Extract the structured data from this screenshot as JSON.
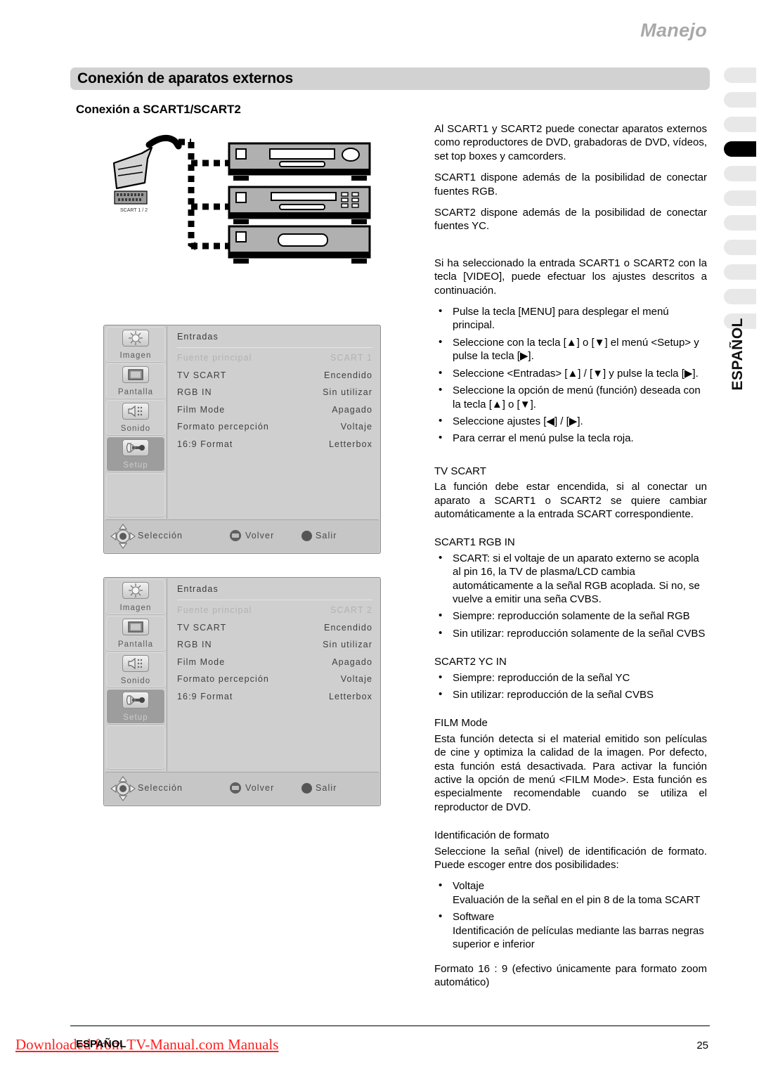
{
  "header": {
    "running_title": "Manejo",
    "section_title": "Conexión de aparatos externos",
    "subtitle": "Conexión a SCART1/SCART2"
  },
  "side_tab": {
    "language_label": "ESPAÑOL",
    "tab_count": 11,
    "active_tab_index": 4,
    "inactive_color": "#e8e8e8",
    "active_color": "#000000"
  },
  "diagram": {
    "connector_label": "SCART 1 / 2",
    "device_count": 3
  },
  "osd_menus": [
    {
      "categories": [
        {
          "label": "Imagen",
          "icon": "picture-icon",
          "selected": false
        },
        {
          "label": "Pantalla",
          "icon": "screen-icon",
          "selected": false
        },
        {
          "label": "Sonido",
          "icon": "speaker-icon",
          "selected": false
        },
        {
          "label": "Setup",
          "icon": "tools-icon",
          "selected": true
        }
      ],
      "heading": "Entradas",
      "rows": [
        {
          "key": "Fuente principal",
          "value": "SCART 1",
          "dimmed": true
        },
        {
          "key": "TV SCART",
          "value": "Encendido",
          "dimmed": false
        },
        {
          "key": "RGB IN",
          "value": "Sin utilizar",
          "dimmed": false
        },
        {
          "key": "Film Mode",
          "value": "Apagado",
          "dimmed": false
        },
        {
          "key": "Formato percepción",
          "value": "Voltaje",
          "dimmed": false
        },
        {
          "key": "16:9 Format",
          "value": "Letterbox",
          "dimmed": false
        }
      ],
      "hints": {
        "selection": "Selección",
        "back": "Volver",
        "exit": "Salir"
      }
    },
    {
      "categories": [
        {
          "label": "Imagen",
          "icon": "picture-icon",
          "selected": false
        },
        {
          "label": "Pantalla",
          "icon": "screen-icon",
          "selected": false
        },
        {
          "label": "Sonido",
          "icon": "speaker-icon",
          "selected": false
        },
        {
          "label": "Setup",
          "icon": "tools-icon",
          "selected": true
        }
      ],
      "heading": "Entradas",
      "rows": [
        {
          "key": "Fuente principal",
          "value": "SCART 2",
          "dimmed": true
        },
        {
          "key": "TV SCART",
          "value": "Encendido",
          "dimmed": false
        },
        {
          "key": "RGB IN",
          "value": "Sin utilizar",
          "dimmed": false
        },
        {
          "key": "Film Mode",
          "value": "Apagado",
          "dimmed": false
        },
        {
          "key": "Formato percepción",
          "value": "Voltaje",
          "dimmed": false
        },
        {
          "key": "16:9 Format",
          "value": "Letterbox",
          "dimmed": false
        }
      ],
      "hints": {
        "selection": "Selección",
        "back": "Volver",
        "exit": "Salir"
      }
    }
  ],
  "body": {
    "intro": [
      "Al SCART1 y SCART2 puede conectar aparatos externos como reproductores de DVD, grabadoras de DVD, vídeos, set top boxes y camcorders.",
      "SCART1 dispone además de la posibilidad de conectar fuentes RGB.",
      "SCART2 dispone además de la posibilidad de conectar fuentes YC."
    ],
    "procedure_intro": "Si ha seleccionado la entrada SCART1 o SCART2 con la tecla [VIDEO], puede efectuar los ajustes descritos a continuación.",
    "procedure_steps": [
      "Pulse la tecla [MENU] para desplegar el menú principal.",
      "Seleccione con la tecla [▲] o [▼] el menú <Setup> y pulse la tecla [▶].",
      "Seleccione <Entradas> [▲] / [▼] y pulse la tecla [▶].",
      "Seleccione la opción de menú (función) deseada con la tecla [▲] o [▼].",
      "Seleccione ajustes [◀] / [▶].",
      "Para cerrar el menú pulse la tecla roja."
    ],
    "tv_scart": {
      "heading": "TV SCART",
      "text": "La función debe estar encendida, si al conectar un aparato a SCART1 o SCART2 se quiere cambiar automáticamente a la entrada SCART correspondiente."
    },
    "scart1_rgb_in": {
      "heading": "SCART1 RGB IN",
      "items": [
        "SCART: si el voltaje de un aparato externo se acopla al pin 16, la TV de plasma/LCD cambia automáticamente a la señal RGB acoplada. Si no, se vuelve a emitir una seña CVBS.",
        "Siempre: reproducción solamente de la señal RGB",
        "Sin utilizar: reproducción solamente de la señal CVBS"
      ]
    },
    "scart2_yc_in": {
      "heading": "SCART2 YC IN",
      "items": [
        "Siempre: reproducción de la señal YC",
        "Sin utilizar: reproducción de la señal CVBS"
      ]
    },
    "film_mode": {
      "heading": "FILM Mode",
      "text": "Esta función detecta si el material emitido son películas de cine y optimiza la calidad de la imagen. Por defecto, esta función está desactivada. Para activar la función active la opción de menú <FILM Mode>. Esta función es especialmente recomendable cuando se utiliza el reproductor de DVD."
    },
    "format_id": {
      "heading": "Identificación de formato",
      "text": "Seleccione la señal (nivel) de identificación de formato. Puede escoger entre dos posibilidades:",
      "items": [
        {
          "title": "Voltaje",
          "detail": "Evaluación de la señal en el pin 8 de la toma SCART"
        },
        {
          "title": "Software",
          "detail": "Identificación de películas mediante las barras negras superior e inferior"
        }
      ],
      "closing": "Formato 16 : 9 (efectivo únicamente para formato zoom automático)"
    }
  },
  "footer": {
    "language": "ESPAÑOL",
    "page_number": "25",
    "watermark": "Downloaded from TV-Manual.com Manuals",
    "watermark_color": "#ff2020"
  }
}
